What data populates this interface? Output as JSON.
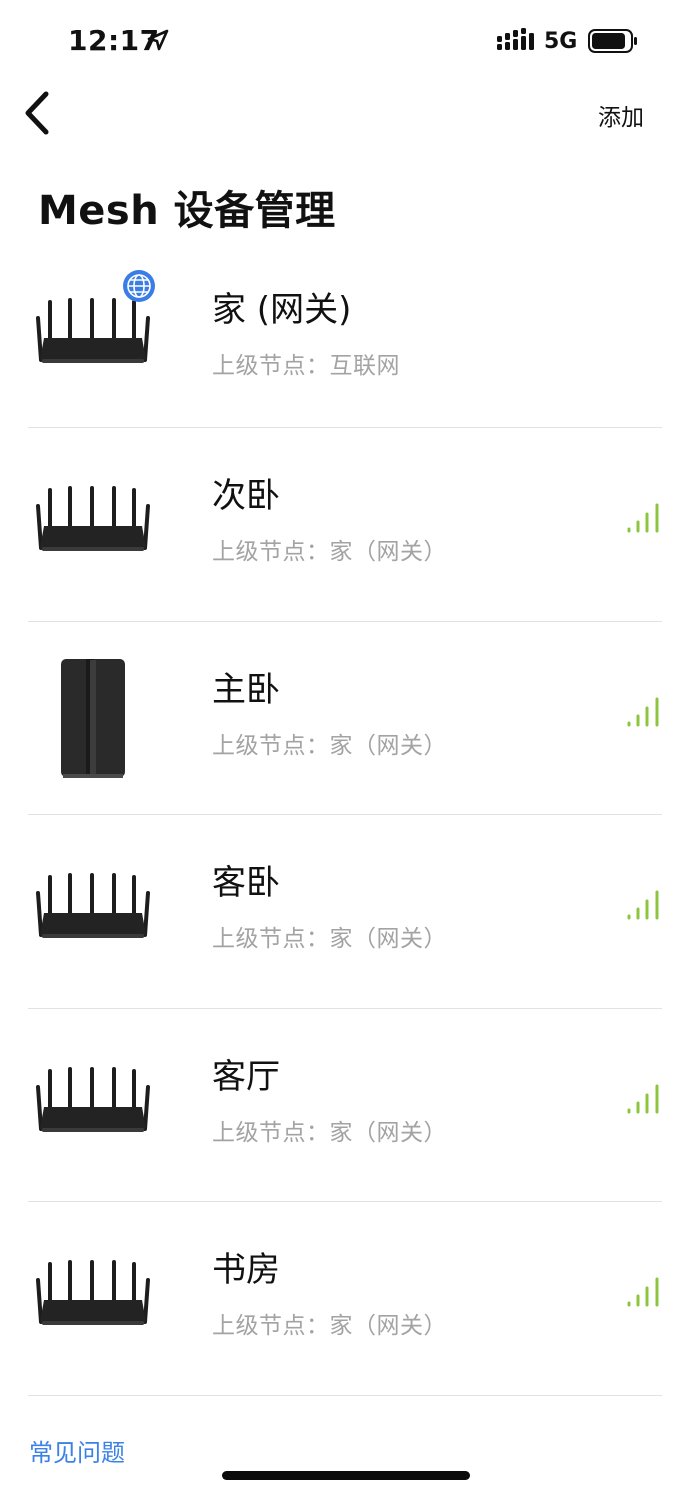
{
  "status_bar": {
    "time": "12:17",
    "network": "5G",
    "location_icon": "location-arrow-icon",
    "signal_icon": "cellular-signal-icon",
    "battery_icon": "battery-icon"
  },
  "nav": {
    "back_icon": "chevron-left-icon",
    "add_label": "添加"
  },
  "page": {
    "title": "Mesh 设备管理"
  },
  "devices": [
    {
      "name": "家 (网关)",
      "parent": "上级节点：互联网",
      "type": "router",
      "badge": "globe-icon",
      "signal": null
    },
    {
      "name": "次卧",
      "parent": "上级节点：家（网关）",
      "type": "router",
      "badge": null,
      "signal": "wifi-signal-strength-icon"
    },
    {
      "name": "主卧",
      "parent": "上级节点：家（网关）",
      "type": "tower",
      "badge": null,
      "signal": "wifi-signal-strength-icon"
    },
    {
      "name": "客卧",
      "parent": "上级节点：家（网关）",
      "type": "router",
      "badge": null,
      "signal": "wifi-signal-strength-icon"
    },
    {
      "name": "客厅",
      "parent": "上级节点：家（网关）",
      "type": "router",
      "badge": null,
      "signal": "wifi-signal-strength-icon"
    },
    {
      "name": "书房",
      "parent": "上级节点：家（网关）",
      "type": "router",
      "badge": null,
      "signal": "wifi-signal-strength-icon"
    }
  ],
  "footer": {
    "faq_label": "常见问题"
  },
  "colors": {
    "accent": "#3b82e8",
    "signal": "#8cc63f",
    "secondary_text": "#a3a3a3",
    "divider": "#e2e2e2"
  }
}
